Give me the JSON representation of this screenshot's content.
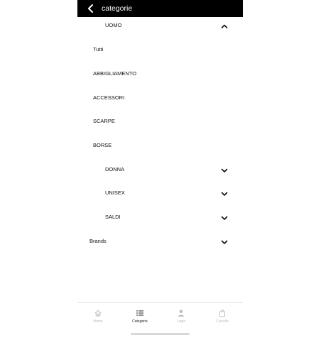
{
  "header": {
    "title": "categorie",
    "back_icon": "chevron-left-icon"
  },
  "categories": {
    "uomo": "UOMO",
    "items": [
      "Tutti",
      "ABBIGLIAMENTO",
      "ACCESSORI",
      "SCARPE",
      "BORSE"
    ],
    "donna": "DONNA",
    "unisex": "UNISEX",
    "saldi": "SALDI",
    "brands": "Brands"
  },
  "tabbar": {
    "tabs": [
      {
        "label": "Home",
        "icon": "home-icon",
        "active": false
      },
      {
        "label": "Categorie",
        "icon": "list-icon",
        "active": true
      },
      {
        "label": "Login",
        "icon": "user-icon",
        "active": false
      },
      {
        "label": "Carrello",
        "icon": "bag-icon",
        "active": false
      }
    ]
  },
  "colors": {
    "header_bg": "#000000",
    "header_text": "#ffffff",
    "text": "#111111",
    "inactive_tab": "#bdbdbd",
    "active_tab": "#222222"
  }
}
